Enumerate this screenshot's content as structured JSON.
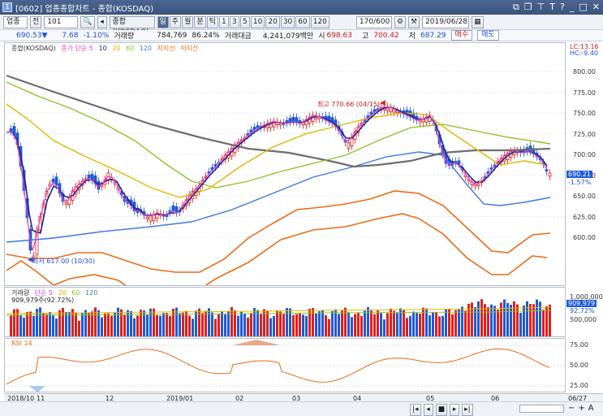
{
  "window": {
    "title": "[0602] 업종종합차트 - 종합(KOSDAQ)",
    "app_icon": "1"
  },
  "toolbar": {
    "market": "업종",
    "period_type": "전",
    "code": "101",
    "name": "종합(KOSDAQ)",
    "intervals": [
      "일",
      "주",
      "월",
      "분",
      "틱",
      "1",
      "3",
      "5",
      "10",
      "20",
      "30",
      "60",
      "120"
    ],
    "count": "170/600",
    "date": "2019/06/28"
  },
  "quote": {
    "price": "690.53▼",
    "change": "7.68",
    "change_pct": "-1.10%",
    "volume_label": "거래량",
    "volume": "784,769",
    "volume_pct": "86.24%",
    "amount_label": "거래대금",
    "amount": "4,241,079백만",
    "open_label": "시",
    "open": "698.63",
    "high_label": "고",
    "high": "700.42",
    "low_label": "저",
    "low": "687.29",
    "buy": "매수",
    "sell": "매도"
  },
  "price_panel": {
    "legend": [
      "종합(KOSDAQ)",
      "종가 단순 5",
      "10",
      "20",
      "60",
      "120",
      "지지선",
      "저지선"
    ],
    "high_annotation": "최고 770.66 (04/15)",
    "low_annotation": "최저 617.00 (10/30)",
    "lc": "LC:13.16",
    "hc": "HC:-9.40",
    "current_tag": "690.21",
    "current_pct": "-1.57%",
    "y_ticks": [
      "800.00",
      "775.00",
      "750.00",
      "725.00",
      "700.00",
      "675.00",
      "650.00",
      "625.00",
      "600.00"
    ]
  },
  "volume_panel": {
    "legend": [
      "거래량",
      "단순 5",
      "20",
      "60",
      "120"
    ],
    "value": "909,979주(92.72%)",
    "tag": "909,979",
    "tag_pct": "92.72%",
    "y_ticks": [
      "1,000,000",
      "500,000"
    ]
  },
  "rsi_panel": {
    "legend": "RSI 14",
    "y_ticks": [
      "75.00",
      "50.00",
      "25.00"
    ]
  },
  "x_axis": {
    "labels": [
      "2018/10",
      "11",
      "12",
      "2019/01",
      "02",
      "03",
      "04",
      "05",
      "06",
      "06/27"
    ]
  },
  "colors": {
    "up": "#e0201b",
    "down": "#1e5bd8",
    "ma5": "#e93cc0",
    "ma10": "#1b2a8c",
    "ma20": "#e0b800",
    "ma60": "#8fc22a",
    "ma120": "#3b78e7",
    "support": "#ee6a14"
  }
}
